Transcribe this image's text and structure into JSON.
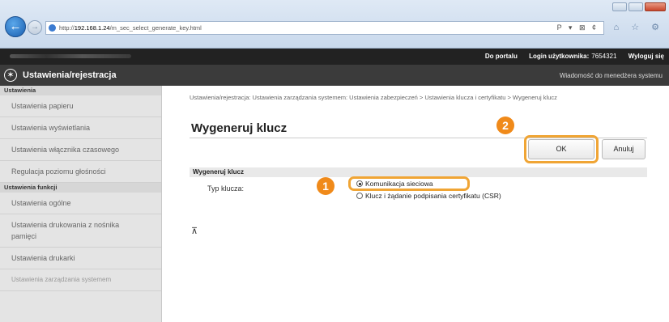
{
  "browser": {
    "back_icon": "arrow-left-icon",
    "forward_icon": "arrow-right-icon",
    "url_prefix": "http://",
    "url_host": "192.168.1.24",
    "url_path": "/m_sec_select_generate_key.html",
    "address_tools": "P ▾ ⊠ ¢",
    "toolbar_icons": "⌂ ☆ ⚙"
  },
  "top_links": {
    "portal": "Do portalu",
    "login_label": "Login użytkownika:",
    "login_value": "7654321",
    "logout": "Wyloguj się"
  },
  "header": {
    "icon": "settings-icon",
    "title": "Ustawienia/rejestracja",
    "manager_message": "Wiadomość do menedżera systemu"
  },
  "sidebar": {
    "sections": [
      {
        "heading": "Ustawienia",
        "items": [
          "Ustawienia papieru",
          "Ustawienia wyświetlania",
          "Ustawienia włącznika czasowego",
          "Regulacja poziomu głośności"
        ]
      },
      {
        "heading": "Ustawienia funkcji",
        "items": [
          "Ustawienia ogólne",
          "Ustawienia drukowania z nośnika pamięci",
          "Ustawienia drukarki"
        ]
      }
    ],
    "bottom_item": "Ustawienia zarządzania systemem"
  },
  "main": {
    "breadcrumb": "Ustawienia/rejestracja: Ustawienia zarządzania systemem: Ustawienia zabezpieczeń > Ustawienia klucza i certyfikatu > Wygeneruj klucz",
    "title": "Wygeneruj klucz",
    "ok_button": "OK",
    "cancel_button": "Anuluj",
    "section_heading": "Wygeneruj klucz",
    "key_type_label": "Typ klucza:",
    "options": [
      {
        "label": "Komunikacja sieciowa",
        "selected": true
      },
      {
        "label": "Klucz i żądanie podpisania certyfikatu (CSR)",
        "selected": false
      }
    ],
    "top_link": "⊼"
  },
  "callouts": {
    "step1": "1",
    "step2": "2",
    "color": "#f08a1a",
    "highlight_color": "#f0a535"
  }
}
